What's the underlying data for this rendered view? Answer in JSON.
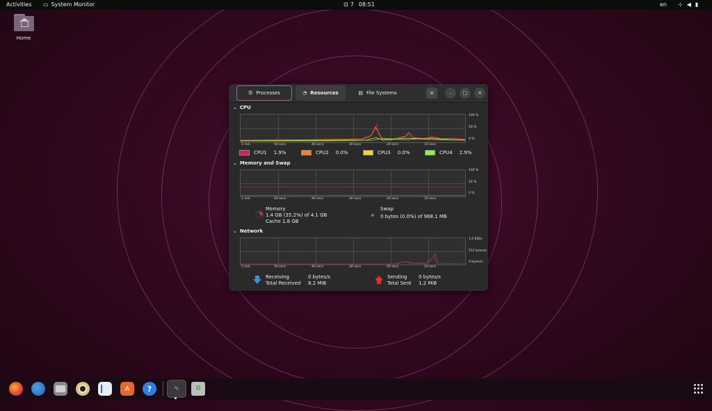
{
  "topbar": {
    "activities": "Activities",
    "app_name": "System Monitor",
    "notif_count": "7",
    "time": "08:51",
    "lang": "en"
  },
  "desktop": {
    "home_label": "Home"
  },
  "window": {
    "tabs": {
      "processes": "Processes",
      "resources": "Resources",
      "file_systems": "File Systems"
    },
    "cpu": {
      "title": "CPU",
      "y_ticks": [
        "100 %",
        "50 %",
        "0 %"
      ],
      "x_ticks": [
        "1 min",
        "50 secs",
        "40 secs",
        "30 secs",
        "20 secs",
        "10 secs"
      ],
      "legend": [
        {
          "label": "CPU1",
          "value": "1.9%",
          "color": "#e01b4c"
        },
        {
          "label": "CPU2",
          "value": "0.0%",
          "color": "#ff7f2a"
        },
        {
          "label": "CPU3",
          "value": "0.0%",
          "color": "#f6d32d"
        },
        {
          "label": "CPU4",
          "value": "2.9%",
          "color": "#8ff045"
        }
      ]
    },
    "memory": {
      "title": "Memory and Swap",
      "y_ticks": [
        "100 %",
        "50 %",
        "0 %"
      ],
      "x_ticks": [
        "1 min",
        "50 secs",
        "40 secs",
        "30 secs",
        "20 secs",
        "10 secs"
      ],
      "mem_label": "Memory",
      "mem_value": "1.4 GB (35.2%) of 4.1 GB",
      "mem_cache": "Cache 1.8 GB",
      "mem_fraction": 0.352,
      "swap_label": "Swap",
      "swap_value": "0 bytes (0.0%) of 968.1 MB"
    },
    "network": {
      "title": "Network",
      "y_ticks": [
        "1.0 KiB/s",
        "512 bytes/s",
        "0 bytes/s"
      ],
      "x_ticks": [
        "1 min",
        "50 secs",
        "40 secs",
        "30 secs",
        "20 secs",
        "10 secs"
      ],
      "receiving_label": "Receiving",
      "receiving_value": "0 bytes/s",
      "total_received_label": "Total Received",
      "total_received_value": "8.2 MiB",
      "sending_label": "Sending",
      "sending_value": "0 bytes/s",
      "total_sent_label": "Total Sent",
      "total_sent_value": "1.2 MiB"
    }
  },
  "dock": [
    "firefox-icon",
    "thunderbird-icon",
    "files-icon",
    "rhythmbox-icon",
    "writer-icon",
    "software-icon",
    "help-icon",
    "system-monitor-icon",
    "trash-icon"
  ]
}
